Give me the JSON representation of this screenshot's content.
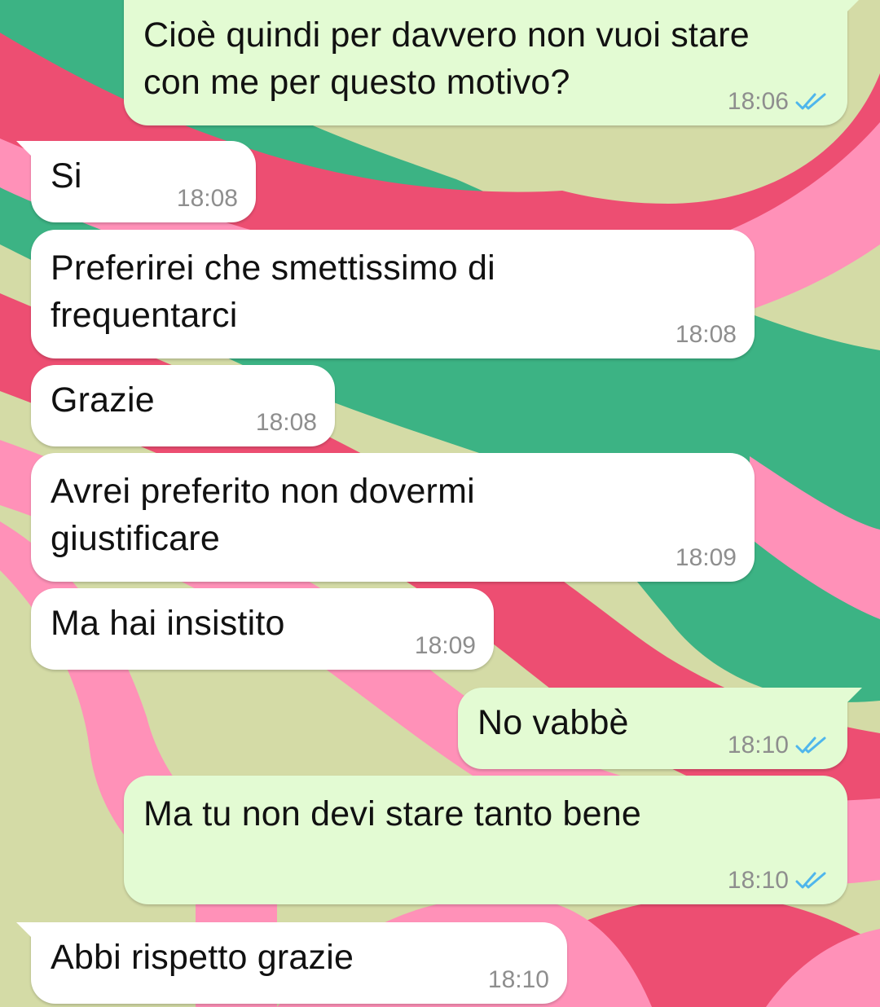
{
  "colors": {
    "outgoing_bubble": "#e3fbd3",
    "incoming_bubble": "#ffffff",
    "read_ticks": "#4fb6ec",
    "wallpaper_olive": "#d4dba6",
    "wallpaper_green": "#3cb384",
    "wallpaper_pink": "#ff91b8",
    "wallpaper_red": "#ed4e72"
  },
  "messages": [
    {
      "direction": "outgoing",
      "text": "Cioè quindi per davvero non vuoi stare\ncon me per questo motivo?",
      "time": "18:06",
      "status_icon": "double-check-read-icon"
    },
    {
      "direction": "incoming",
      "text": "Si",
      "time": "18:08"
    },
    {
      "direction": "incoming",
      "text": "Preferirei che smettissimo di\nfrequentarci",
      "time": "18:08"
    },
    {
      "direction": "incoming",
      "text": "Grazie",
      "time": "18:08"
    },
    {
      "direction": "incoming",
      "text": "Avrei preferito non dovermi\ngiustificare",
      "time": "18:09"
    },
    {
      "direction": "incoming",
      "text": "Ma hai insistito",
      "time": "18:09"
    },
    {
      "direction": "outgoing",
      "text": "No vabbè",
      "time": "18:10",
      "status_icon": "double-check-read-icon"
    },
    {
      "direction": "outgoing",
      "text": "Ma tu non devi stare tanto bene",
      "time": "18:10",
      "status_icon": "double-check-read-icon"
    },
    {
      "direction": "incoming",
      "text": "Abbi rispetto grazie",
      "time": "18:10"
    }
  ]
}
